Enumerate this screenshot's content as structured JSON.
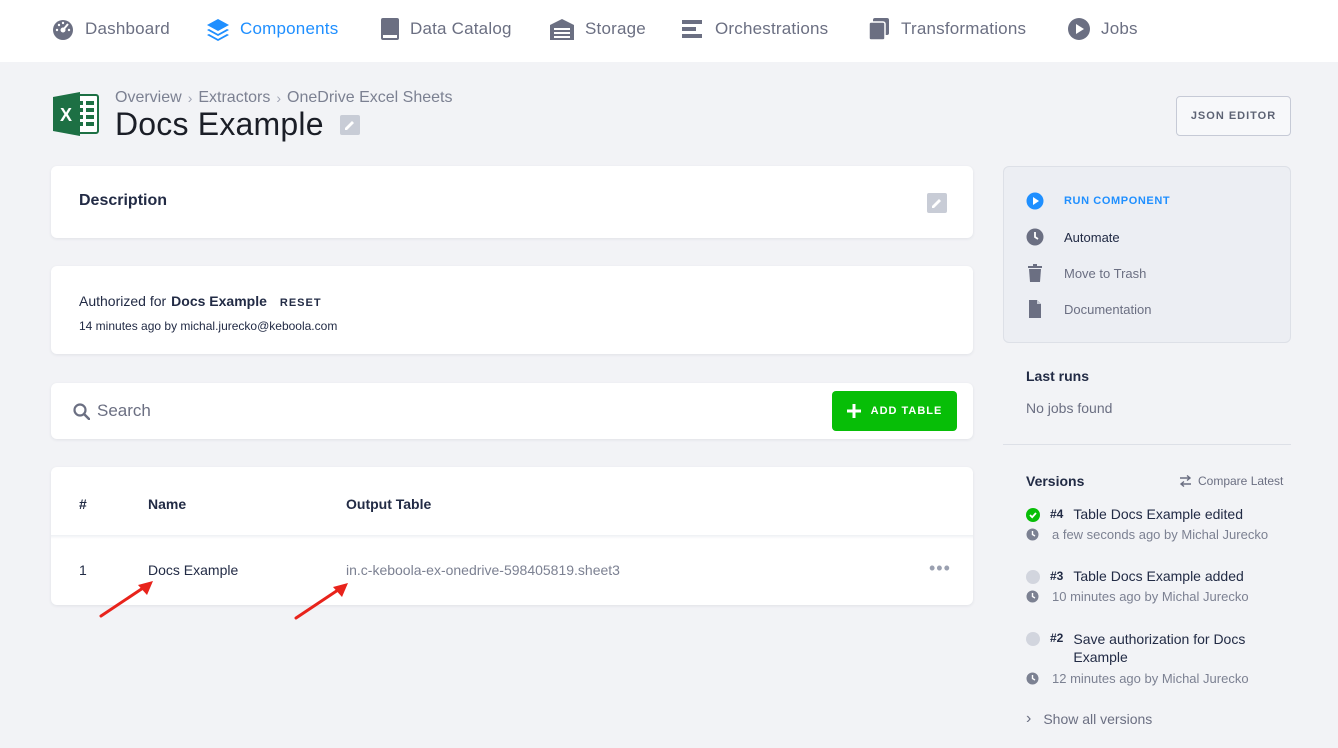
{
  "nav": {
    "items": [
      {
        "label": "Dashboard",
        "icon": "gauge-icon"
      },
      {
        "label": "Components",
        "icon": "layers-icon",
        "active": true
      },
      {
        "label": "Data Catalog",
        "icon": "book-icon"
      },
      {
        "label": "Storage",
        "icon": "warehouse-icon"
      },
      {
        "label": "Orchestrations",
        "icon": "bars-icon"
      },
      {
        "label": "Transformations",
        "icon": "copy-icon"
      },
      {
        "label": "Jobs",
        "icon": "play-circle-icon"
      }
    ]
  },
  "breadcrumb": [
    "Overview",
    "Extractors",
    "OneDrive Excel Sheets"
  ],
  "page": {
    "title": "Docs Example",
    "json_editor_label": "JSON EDITOR"
  },
  "description": {
    "title": "Description"
  },
  "authorization": {
    "prefix": "Authorized for",
    "name": "Docs Example",
    "reset_label": "RESET",
    "meta": "14 minutes ago by michal.jurecko@keboola.com"
  },
  "search": {
    "placeholder": "Search",
    "add_label": "ADD TABLE"
  },
  "table": {
    "headers": [
      "#",
      "Name",
      "Output Table"
    ],
    "rows": [
      {
        "num": "1",
        "name": "Docs Example",
        "output": "in.c-keboola-ex-onedrive-598405819.sheet3"
      }
    ],
    "row_menu": "•••"
  },
  "sidebar": {
    "actions": [
      {
        "label": "RUN COMPONENT",
        "icon": "play-circle-icon"
      },
      {
        "label": "Automate",
        "icon": "clock-icon"
      },
      {
        "label": "Move to Trash",
        "icon": "trash-icon"
      },
      {
        "label": "Documentation",
        "icon": "document-icon"
      }
    ],
    "last_runs_title": "Last runs",
    "no_jobs": "No jobs found",
    "versions_title": "Versions",
    "compare_label": "Compare Latest",
    "versions": [
      {
        "num": "#4",
        "title": "Table Docs Example edited",
        "meta": "a few seconds ago by Michal Jurecko",
        "status": "success"
      },
      {
        "num": "#3",
        "title": "Table Docs Example added",
        "meta": "10 minutes ago by Michal Jurecko",
        "status": "inactive"
      },
      {
        "num": "#2",
        "title": "Save authorization for Docs Example",
        "meta": "12 minutes ago by Michal Jurecko",
        "status": "inactive"
      }
    ],
    "show_all_label": "Show all versions"
  },
  "colors": {
    "accent": "#1f8fff",
    "success": "#07be07",
    "annotation": "#e8231b"
  }
}
